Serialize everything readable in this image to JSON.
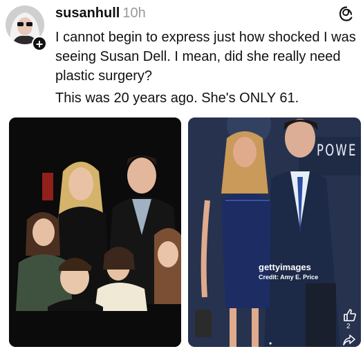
{
  "post": {
    "username": "susanhull",
    "time": "10h",
    "paragraphs": [
      "I cannot begin to express just how shocked I was seeing Susan Dell.  I mean, did she really need plastic surgery?",
      "This was 20 years ago.  She's ONLY 61."
    ]
  },
  "avatar": {
    "badge": "+"
  },
  "images": {
    "right": {
      "watermark_brand": "gettyimages",
      "watermark_credit": "Credit: Amy E. Price",
      "backdrop_text": "POWE",
      "like_count": "2",
      "pager": "•"
    }
  },
  "icons": {
    "threads": "threads-logo-icon",
    "like": "thumbs-up-icon",
    "share": "share-arrow-icon",
    "follow": "plus-icon"
  },
  "colors": {
    "text": "#111111",
    "muted": "#999999",
    "right_photo_bg": "#25314d"
  }
}
